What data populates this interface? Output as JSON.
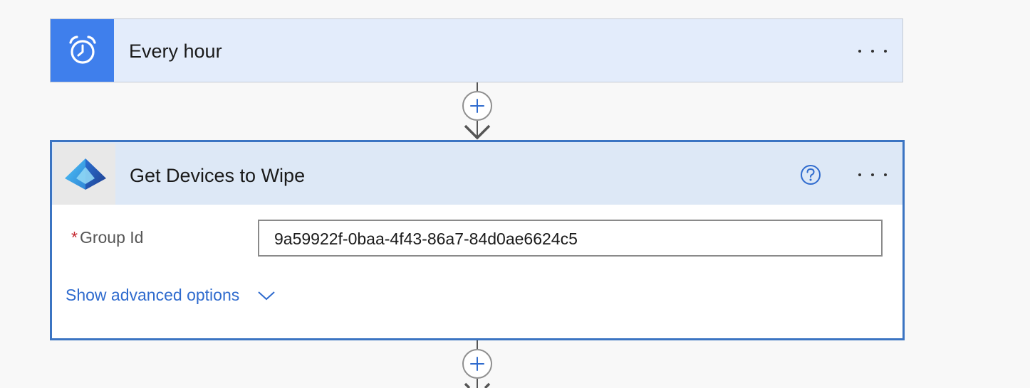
{
  "trigger": {
    "title": "Every hour",
    "icon": "alarm-clock-icon",
    "icon_bg_color": "#3f7fec",
    "card_bg_color": "#e3ecfb"
  },
  "action": {
    "title": "Get Devices to Wipe",
    "icon": "azure-ad-icon",
    "header_bg_color": "#dde8f6",
    "border_color": "#3b74c2",
    "fields": [
      {
        "required_marker": "*",
        "label": "Group Id",
        "value": "9a59922f-0baa-4f43-86a7-84d0ae6624c5"
      }
    ],
    "advanced_label": "Show advanced options"
  }
}
